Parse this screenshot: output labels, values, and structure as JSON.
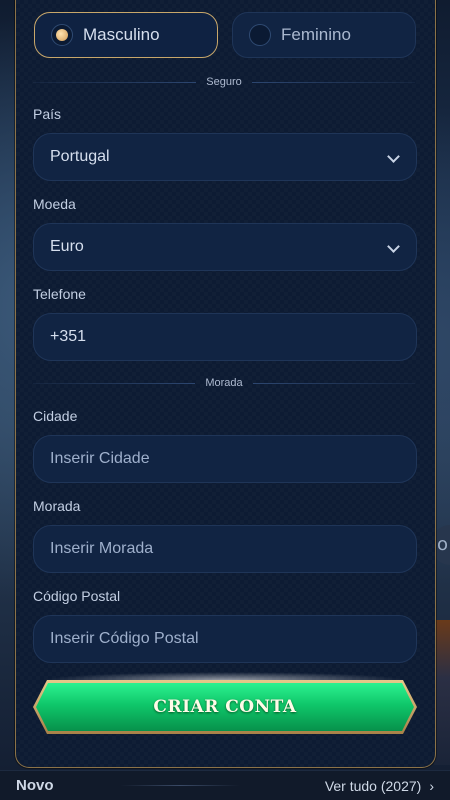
{
  "gender": {
    "options": [
      {
        "label": "Masculino",
        "selected": true
      },
      {
        "label": "Feminino",
        "selected": false
      }
    ]
  },
  "section_secure": "Seguro",
  "section_address": "Morada",
  "fields": {
    "country": {
      "label": "País",
      "value": "Portugal"
    },
    "currency": {
      "label": "Moeda",
      "value": "Euro"
    },
    "phone": {
      "label": "Telefone",
      "value": "+351"
    },
    "city": {
      "label": "Cidade",
      "placeholder": "Inserir Cidade"
    },
    "address": {
      "label": "Morada",
      "placeholder": "Inserir Morada"
    },
    "postal": {
      "label": "Código Postal",
      "placeholder": "Inserir Código Postal"
    }
  },
  "submit_label": "CRIAR CONTA",
  "bottom": {
    "left": "Novo",
    "right": "Ver tudo (2027)"
  },
  "colors": {
    "accent_gold": "#c8a76a",
    "cta_green": "#0fc76a",
    "field_bg": "#112443"
  }
}
